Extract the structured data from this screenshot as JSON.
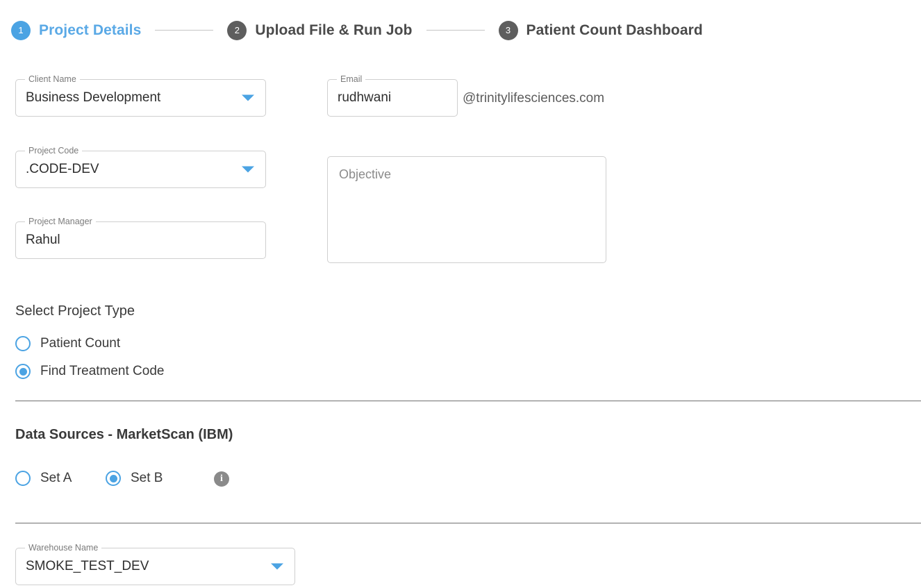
{
  "stepper": {
    "steps": [
      {
        "number": "1",
        "label": "Project Details",
        "state": "active"
      },
      {
        "number": "2",
        "label": "Upload File & Run Job",
        "state": "inactive"
      },
      {
        "number": "3",
        "label": "Patient Count Dashboard",
        "state": "inactive"
      }
    ],
    "active_color": "#4ba3e3",
    "inactive_color": "#5e5e5e"
  },
  "form": {
    "client_name": {
      "label": "Client Name",
      "value": "Business Development"
    },
    "project_code": {
      "label": "Project Code",
      "value": ".CODE-DEV"
    },
    "project_manager": {
      "label": "Project Manager",
      "value": "Rahul"
    },
    "email": {
      "label": "Email",
      "value": "rudhwani",
      "suffix": "@trinitylifesciences.com"
    },
    "objective": {
      "placeholder": "Objective",
      "value": ""
    },
    "warehouse_name": {
      "label": "Warehouse Name",
      "value": "SMOKE_TEST_DEV"
    }
  },
  "project_type": {
    "heading": "Select Project Type",
    "options": [
      {
        "label": "Patient Count",
        "selected": false
      },
      {
        "label": "Find Treatment Code",
        "selected": true
      }
    ]
  },
  "data_sources": {
    "heading": "Data Sources - MarketScan (IBM)",
    "options": [
      {
        "label": "Set A",
        "selected": false
      },
      {
        "label": "Set B",
        "selected": true
      }
    ],
    "info_icon": "info-icon",
    "info_glyph": "i"
  },
  "theme": {
    "accent": "#4ba3e3",
    "border": "#cfcfcf",
    "label_text": "#7b7b7b",
    "body_text": "#3a3a3a"
  }
}
